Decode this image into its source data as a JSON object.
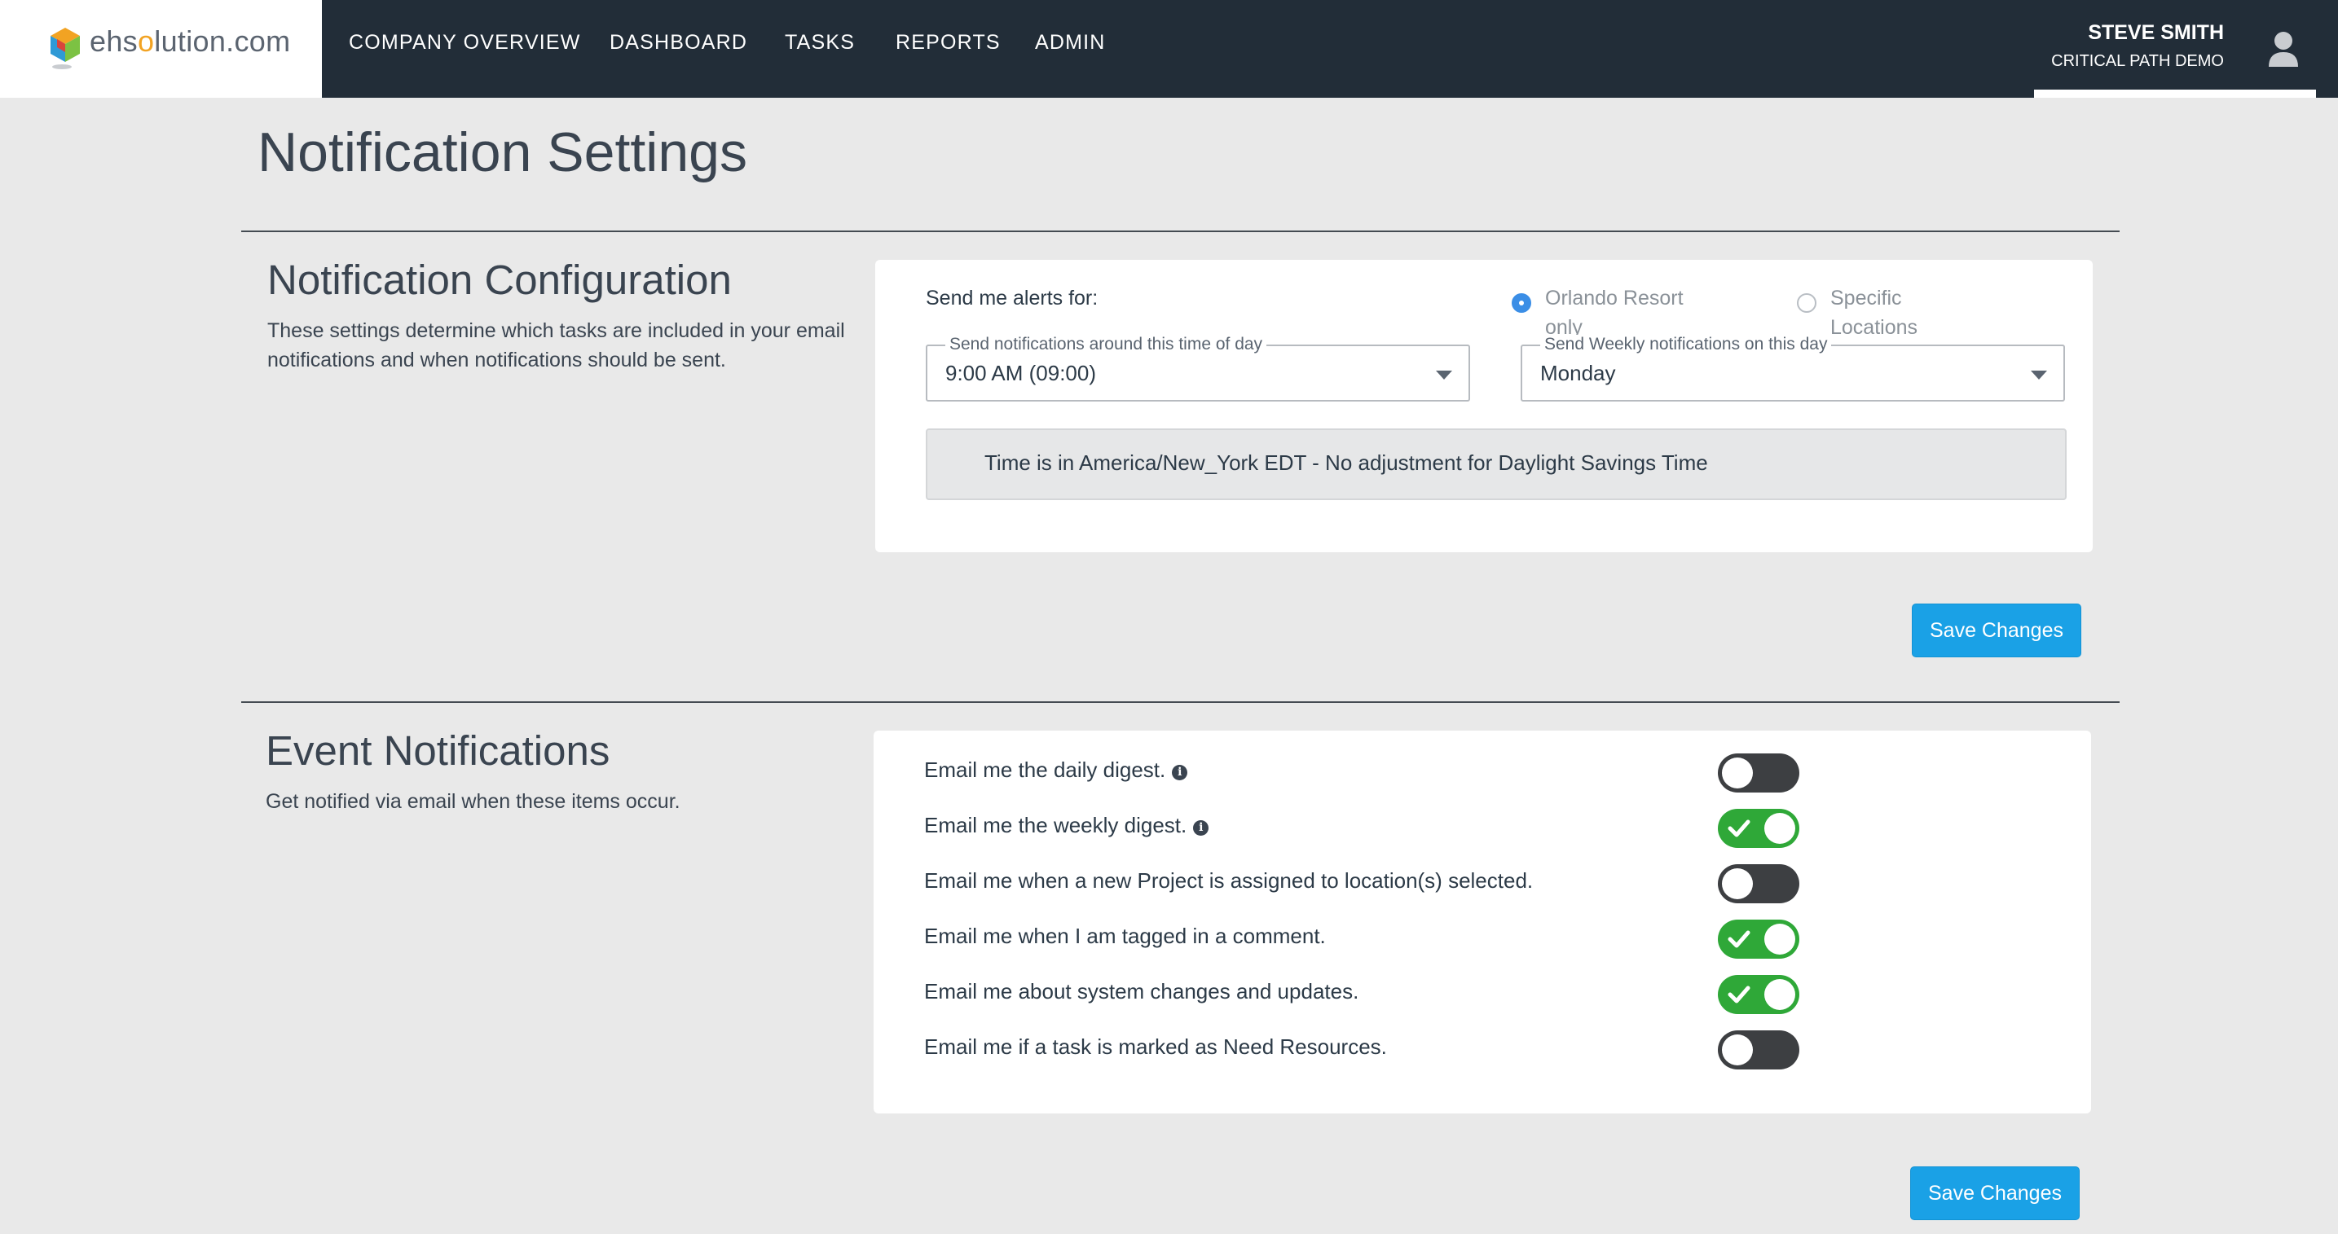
{
  "brand": {
    "logo_prefix": "ehs",
    "logo_o": "o",
    "logo_suffix": "lution.com"
  },
  "nav": {
    "items": [
      {
        "label": "COMPANY OVERVIEW"
      },
      {
        "label": "DASHBOARD"
      },
      {
        "label": "TASKS"
      },
      {
        "label": "REPORTS"
      },
      {
        "label": "ADMIN"
      }
    ]
  },
  "user": {
    "name": "STEVE SMITH",
    "org": "CRITICAL PATH DEMO",
    "icon": "user-icon"
  },
  "page": {
    "title": "Notification Settings"
  },
  "config": {
    "title": "Notification Configuration",
    "description_line1": "These settings determine which tasks are included in your email",
    "description_line2": "notifications and when notifications should be sent.",
    "alerts_label": "Send me alerts for:",
    "radio_options": [
      {
        "line1": "Orlando Resort",
        "line2": "only",
        "selected": true
      },
      {
        "line1": "Specific",
        "line2": "Locations",
        "selected": false
      }
    ],
    "time_select": {
      "legend": "Send notifications around this time of day",
      "value": "9:00 AM (09:00)"
    },
    "day_select": {
      "legend": "Send Weekly notifications on this day",
      "value": "Monday"
    },
    "timezone_note": "Time is in America/New_York EDT - No adjustment for Daylight Savings Time",
    "save_label": "Save Changes"
  },
  "events": {
    "title": "Event Notifications",
    "description": "Get notified via email when these items occur.",
    "rows": [
      {
        "label": "Email me the daily digest.",
        "info": true,
        "enabled": false
      },
      {
        "label": "Email me the weekly digest.",
        "info": true,
        "enabled": true
      },
      {
        "label": "Email me when a new Project is assigned to location(s) selected.",
        "info": false,
        "enabled": false
      },
      {
        "label": "Email me when I am tagged in a comment.",
        "info": false,
        "enabled": true
      },
      {
        "label": "Email me about system changes and updates.",
        "info": false,
        "enabled": true
      },
      {
        "label": "Email me if a task is marked as Need Resources.",
        "info": false,
        "enabled": false
      }
    ],
    "save_label": "Save Changes"
  },
  "colors": {
    "nav_bg": "#222d38",
    "accent": "#1aa1e6",
    "toggle_on": "#2fa838",
    "toggle_off": "#3d3f42",
    "page_bg": "#e9e9e9"
  }
}
